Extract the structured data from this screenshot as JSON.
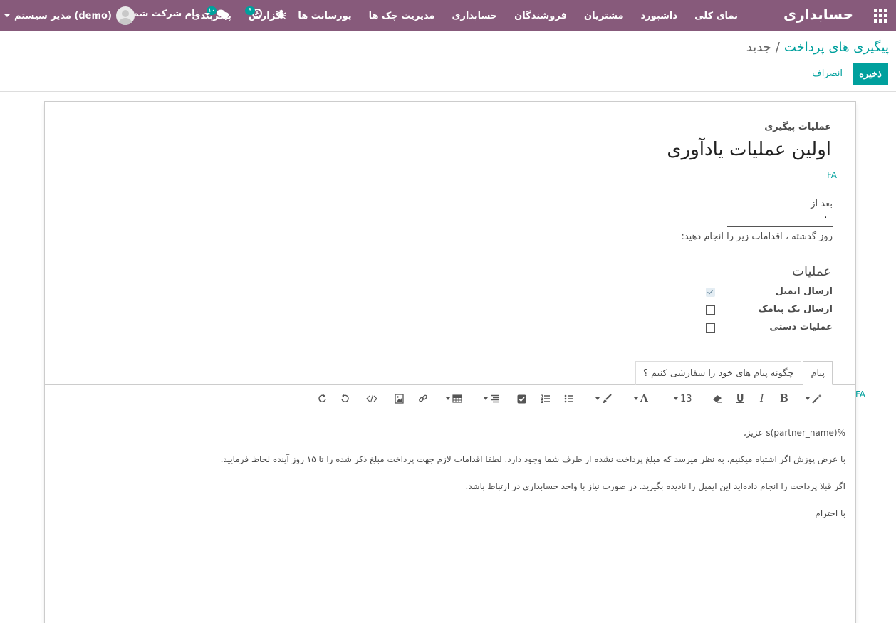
{
  "navbar": {
    "brand": "حسابداری",
    "menu": [
      "نمای کلی",
      "داشبورد",
      "مشتریان",
      "فروشندگان",
      "حسابداری",
      "مدیریت چک ها",
      "پورسانت ها",
      "گزارش",
      "پیکربندی"
    ],
    "user_name": "مدیر سیستم (demo)",
    "company_name": "نام شرکت شما",
    "chat_count": "۱۰",
    "activity_count": "۹",
    "bg_color": "#875a7b"
  },
  "control_panel": {
    "breadcrumb_parent": "پیگیری های پرداخت",
    "breadcrumb_separator": "/",
    "breadcrumb_current": "جدید",
    "save_label": "ذخیره",
    "discard_label": "انصراف",
    "accent_color": "#00a09d"
  },
  "form": {
    "title_label": "عملیات پیگیری",
    "name_value": "اولین عملیات یادآوری",
    "lang_tag": "FA",
    "after_label": "بعد از",
    "after_value": "۰",
    "days_help": "روز گذشته ، اقدامات زیر را انجام دهید:",
    "actions_title": "عملیات",
    "actions": [
      {
        "label": "ارسال ایمیل",
        "checked": true
      },
      {
        "label": "ارسال یک پیامک",
        "checked": false
      },
      {
        "label": "عملیات دستی",
        "checked": false
      }
    ],
    "tabs": [
      {
        "label": "پیام",
        "active": true
      },
      {
        "label": "چگونه پیام های خود را سفارشی کنیم ؟",
        "active": false
      }
    ],
    "toolbar": {
      "font_size": "13",
      "font_color_letter": "A",
      "bold": "B",
      "italic": "I",
      "underline": "U"
    },
    "editor_lang_tag": "FA",
    "message_lines": [
      "%(partner_name)s عزیز،",
      "با عرض پوزش اگر اشتباه میکنیم، به نظر میرسد که مبلغ پرداخت نشده از طرف شما وجود دارد. لطفا اقدامات لازم جهت پرداخت مبلغ ذکر شده را تا ۱۵ روز آینده لحاظ فرمایید.",
      "اگر قبلا پرداخت را انجام داده‌اید این ایمیل را نادیده بگیرید. در صورت نیاز با واحد حسابداری در ارتباط باشد.",
      "با احترام"
    ]
  }
}
